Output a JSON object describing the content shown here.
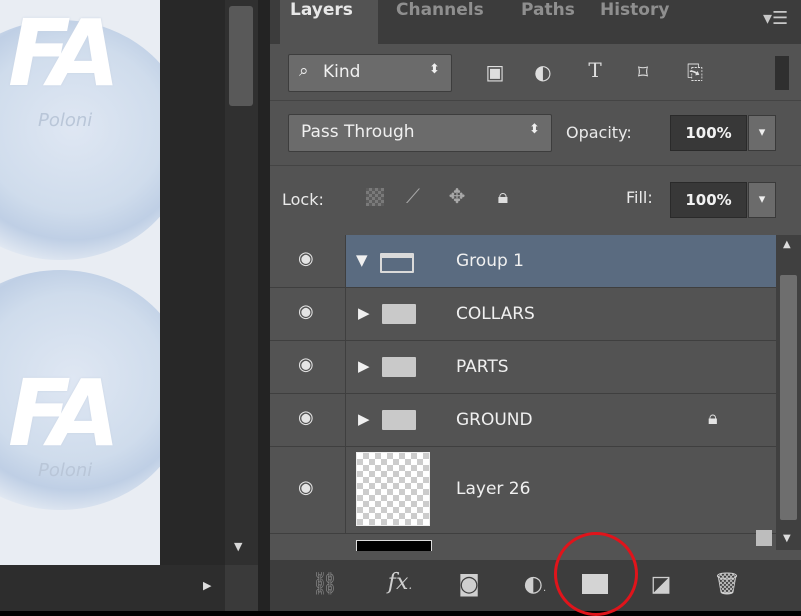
{
  "canvas": {
    "logo_text": "FA",
    "logo_sub": "Poloni"
  },
  "tabs": [
    {
      "label": "Layers",
      "active": true
    },
    {
      "label": "Channels",
      "active": false
    },
    {
      "label": "Paths",
      "active": false
    },
    {
      "label": "History",
      "active": false
    }
  ],
  "panel_menu_icon": "panel-menu-icon",
  "filter": {
    "kind_label": "Kind",
    "kind_icon": "search-icon",
    "icons": [
      "image-filter-icon",
      "adjustment-filter-icon",
      "type-filter-icon",
      "shape-filter-icon",
      "smart-object-filter-icon"
    ]
  },
  "blend": {
    "mode": "Pass Through",
    "opacity_label": "Opacity:",
    "opacity_value": "100%"
  },
  "lock": {
    "label": "Lock:",
    "fill_label": "Fill:",
    "fill_value": "100%"
  },
  "layers": [
    {
      "name": "Group 1",
      "type": "group",
      "expanded": true,
      "selected": true,
      "locked": false
    },
    {
      "name": "COLLARS",
      "type": "group",
      "expanded": false,
      "selected": false,
      "locked": false
    },
    {
      "name": "PARTS",
      "type": "group",
      "expanded": false,
      "selected": false,
      "locked": false
    },
    {
      "name": "GROUND",
      "type": "group",
      "expanded": false,
      "selected": false,
      "locked": true
    },
    {
      "name": "Layer 26",
      "type": "layer",
      "expanded": false,
      "selected": false,
      "locked": false
    }
  ],
  "bottom_toolbar": {
    "icons": [
      "link-layers-icon",
      "fx-icon",
      "layer-mask-icon",
      "adjustment-layer-icon",
      "new-group-icon",
      "new-layer-icon",
      "delete-icon"
    ],
    "fx_label": "fx",
    "highlighted": "new-group-icon",
    "highlight_color": "#e0141b"
  },
  "colors": {
    "selected_row": "#5a6b80",
    "panel_bg": "#535353"
  }
}
